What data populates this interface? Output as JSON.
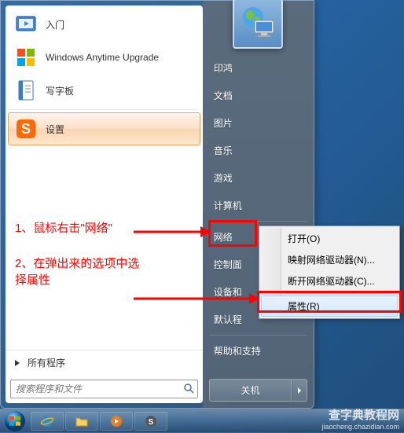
{
  "start_menu": {
    "programs": [
      {
        "label": "入门",
        "icon": "getting-started-icon"
      },
      {
        "label": "Windows Anytime Upgrade",
        "icon": "anytime-upgrade-icon"
      },
      {
        "label": "写字板",
        "icon": "wordpad-icon"
      },
      {
        "label": "设置",
        "icon": "settings-s-icon",
        "highlighted": true
      }
    ],
    "all_programs": "所有程序",
    "search_placeholder": "搜索程序和文件"
  },
  "right_panel": {
    "items_top": [
      "印鸿",
      "文档",
      "图片",
      "音乐",
      "游戏",
      "计算机"
    ],
    "items_mid": [
      "网络",
      "控制面",
      "设备和",
      "默认程"
    ],
    "items_bottom": [
      "帮助和支持"
    ],
    "shutdown": "关机"
  },
  "context_menu": {
    "items": [
      {
        "label": "打开(O)"
      },
      {
        "label": "映射网络驱动器(N)..."
      },
      {
        "label": "断开网络驱动器(C)..."
      },
      {
        "sep": true
      },
      {
        "label": "属性(R)",
        "highlighted": true
      }
    ]
  },
  "annotations": {
    "step1": "1、鼠标右击\"网络\"",
    "step2": "2、在弹出来的选项中选择属性"
  },
  "watermark": {
    "main": "查字典教程网",
    "sub": "jiaocheng.chazidian.com"
  }
}
